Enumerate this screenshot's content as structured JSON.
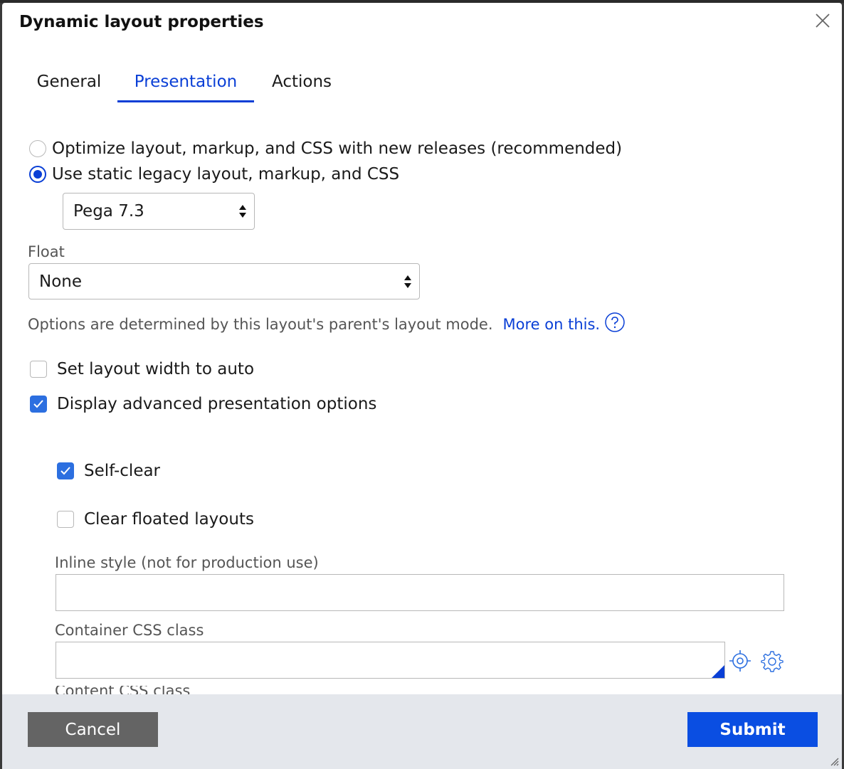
{
  "dialog": {
    "title": "Dynamic layout properties",
    "close_icon": "close-icon"
  },
  "tabs": [
    {
      "label": "General",
      "active": false
    },
    {
      "label": "Presentation",
      "active": true
    },
    {
      "label": "Actions",
      "active": false
    }
  ],
  "layout_mode": {
    "options": [
      {
        "label": "Optimize layout, markup, and CSS with new releases (recommended)",
        "selected": false
      },
      {
        "label": "Use static legacy layout, markup, and CSS",
        "selected": true
      }
    ],
    "version_select_value": "Pega 7.3"
  },
  "float": {
    "label": "Float",
    "value": "None",
    "help_text": "Options are determined by this layout's parent's layout mode.",
    "help_link": "More on this.",
    "help_icon": "question-circle-icon"
  },
  "checkboxes": {
    "width_auto": {
      "label": "Set layout width to auto",
      "checked": false
    },
    "advanced": {
      "label": "Display advanced presentation options",
      "checked": true
    },
    "self_clear": {
      "label": "Self-clear",
      "checked": true
    },
    "clear_floated": {
      "label": "Clear floated layouts",
      "checked": false
    }
  },
  "inline_style": {
    "label": "Inline style (not for production use)",
    "value": ""
  },
  "container_css": {
    "label": "Container CSS class",
    "value": "",
    "icons": [
      "target-icon",
      "gear-icon"
    ]
  },
  "cutoff_label": "Content CSS class",
  "footer": {
    "cancel_label": "Cancel",
    "submit_label": "Submit"
  },
  "colors": {
    "accent": "#0a3fd6",
    "submit_bg": "#0a4ee2",
    "cancel_bg": "#646464",
    "footer_bg": "#e4e7ec"
  }
}
